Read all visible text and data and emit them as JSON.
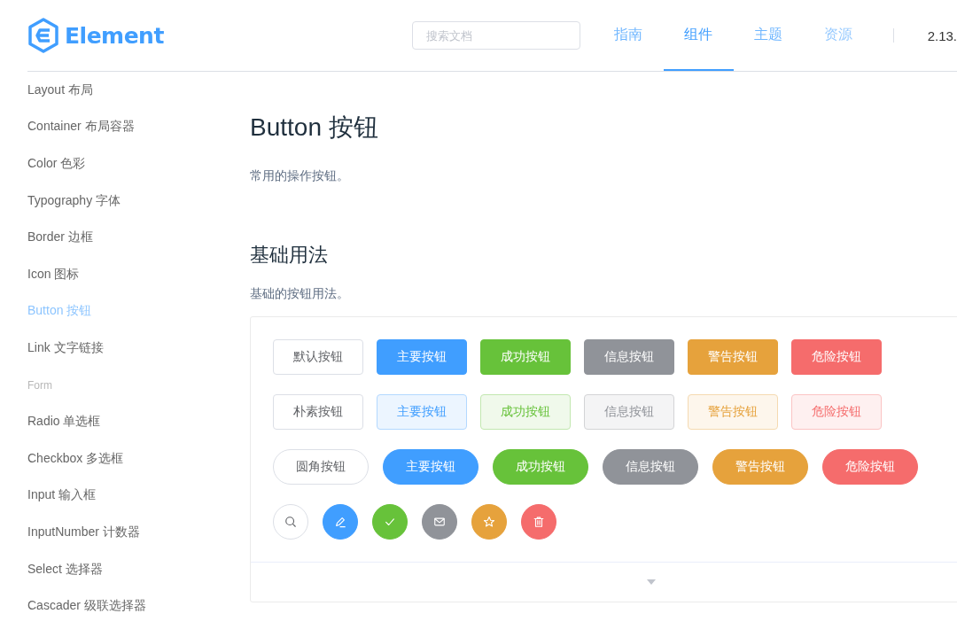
{
  "header": {
    "logo": "Element",
    "search": {
      "placeholder": "搜索文档"
    },
    "nav": [
      {
        "label": "指南",
        "selected": false
      },
      {
        "label": "组件",
        "selected": true
      },
      {
        "label": "主题",
        "selected": false
      },
      {
        "label": "资源",
        "selected": false
      }
    ],
    "version": "2.13."
  },
  "sidebar": {
    "items": [
      {
        "kind": "link",
        "label": "Layout 布局",
        "selected": false
      },
      {
        "kind": "link",
        "label": "Container 布局容器",
        "selected": false
      },
      {
        "kind": "link",
        "label": "Color 色彩",
        "selected": false
      },
      {
        "kind": "link",
        "label": "Typography 字体",
        "selected": false
      },
      {
        "kind": "link",
        "label": "Border 边框",
        "selected": false
      },
      {
        "kind": "link",
        "label": "Icon 图标",
        "selected": false
      },
      {
        "kind": "link",
        "label": "Button 按钮",
        "selected": true
      },
      {
        "kind": "link",
        "label": "Link 文字链接",
        "selected": false
      },
      {
        "kind": "group",
        "label": "Form"
      },
      {
        "kind": "link",
        "label": "Radio 单选框",
        "selected": false
      },
      {
        "kind": "link",
        "label": "Checkbox 多选框",
        "selected": false
      },
      {
        "kind": "link",
        "label": "Input 输入框",
        "selected": false
      },
      {
        "kind": "link",
        "label": "InputNumber 计数器",
        "selected": false
      },
      {
        "kind": "link",
        "label": "Select 选择器",
        "selected": false
      },
      {
        "kind": "link",
        "label": "Cascader 级联选择器",
        "selected": false
      }
    ]
  },
  "content": {
    "title": "Button 按钮",
    "subtitle": "常用的操作按钮。",
    "section_title": "基础用法",
    "section_desc": "基础的按钮用法。",
    "demo_rows": [
      {
        "kind": "default",
        "buttons": [
          {
            "kind": "default",
            "label": "默认按钮"
          },
          {
            "kind": "primary",
            "label": "主要按钮"
          },
          {
            "kind": "success",
            "label": "成功按钮"
          },
          {
            "kind": "info",
            "label": "信息按钮"
          },
          {
            "kind": "warning",
            "label": "警告按钮"
          },
          {
            "kind": "danger",
            "label": "危险按钮"
          }
        ]
      },
      {
        "kind": "plain",
        "buttons": [
          {
            "kind": "default",
            "label": "朴素按钮"
          },
          {
            "kind": "primary",
            "label": "主要按钮"
          },
          {
            "kind": "success",
            "label": "成功按钮"
          },
          {
            "kind": "info",
            "label": "信息按钮"
          },
          {
            "kind": "warning",
            "label": "警告按钮"
          },
          {
            "kind": "danger",
            "label": "危险按钮"
          }
        ]
      },
      {
        "kind": "round",
        "buttons": [
          {
            "kind": "default",
            "label": "圆角按钮"
          },
          {
            "kind": "primary",
            "label": "主要按钮"
          },
          {
            "kind": "success",
            "label": "成功按钮"
          },
          {
            "kind": "info",
            "label": "信息按钮"
          },
          {
            "kind": "warning",
            "label": "警告按钮"
          },
          {
            "kind": "danger",
            "label": "危险按钮"
          }
        ]
      },
      {
        "kind": "circle",
        "buttons": [
          {
            "kind": "default"
          },
          {
            "kind": "primary"
          },
          {
            "kind": "success"
          },
          {
            "kind": "info"
          },
          {
            "kind": "warning"
          },
          {
            "kind": "danger"
          }
        ]
      }
    ]
  }
}
